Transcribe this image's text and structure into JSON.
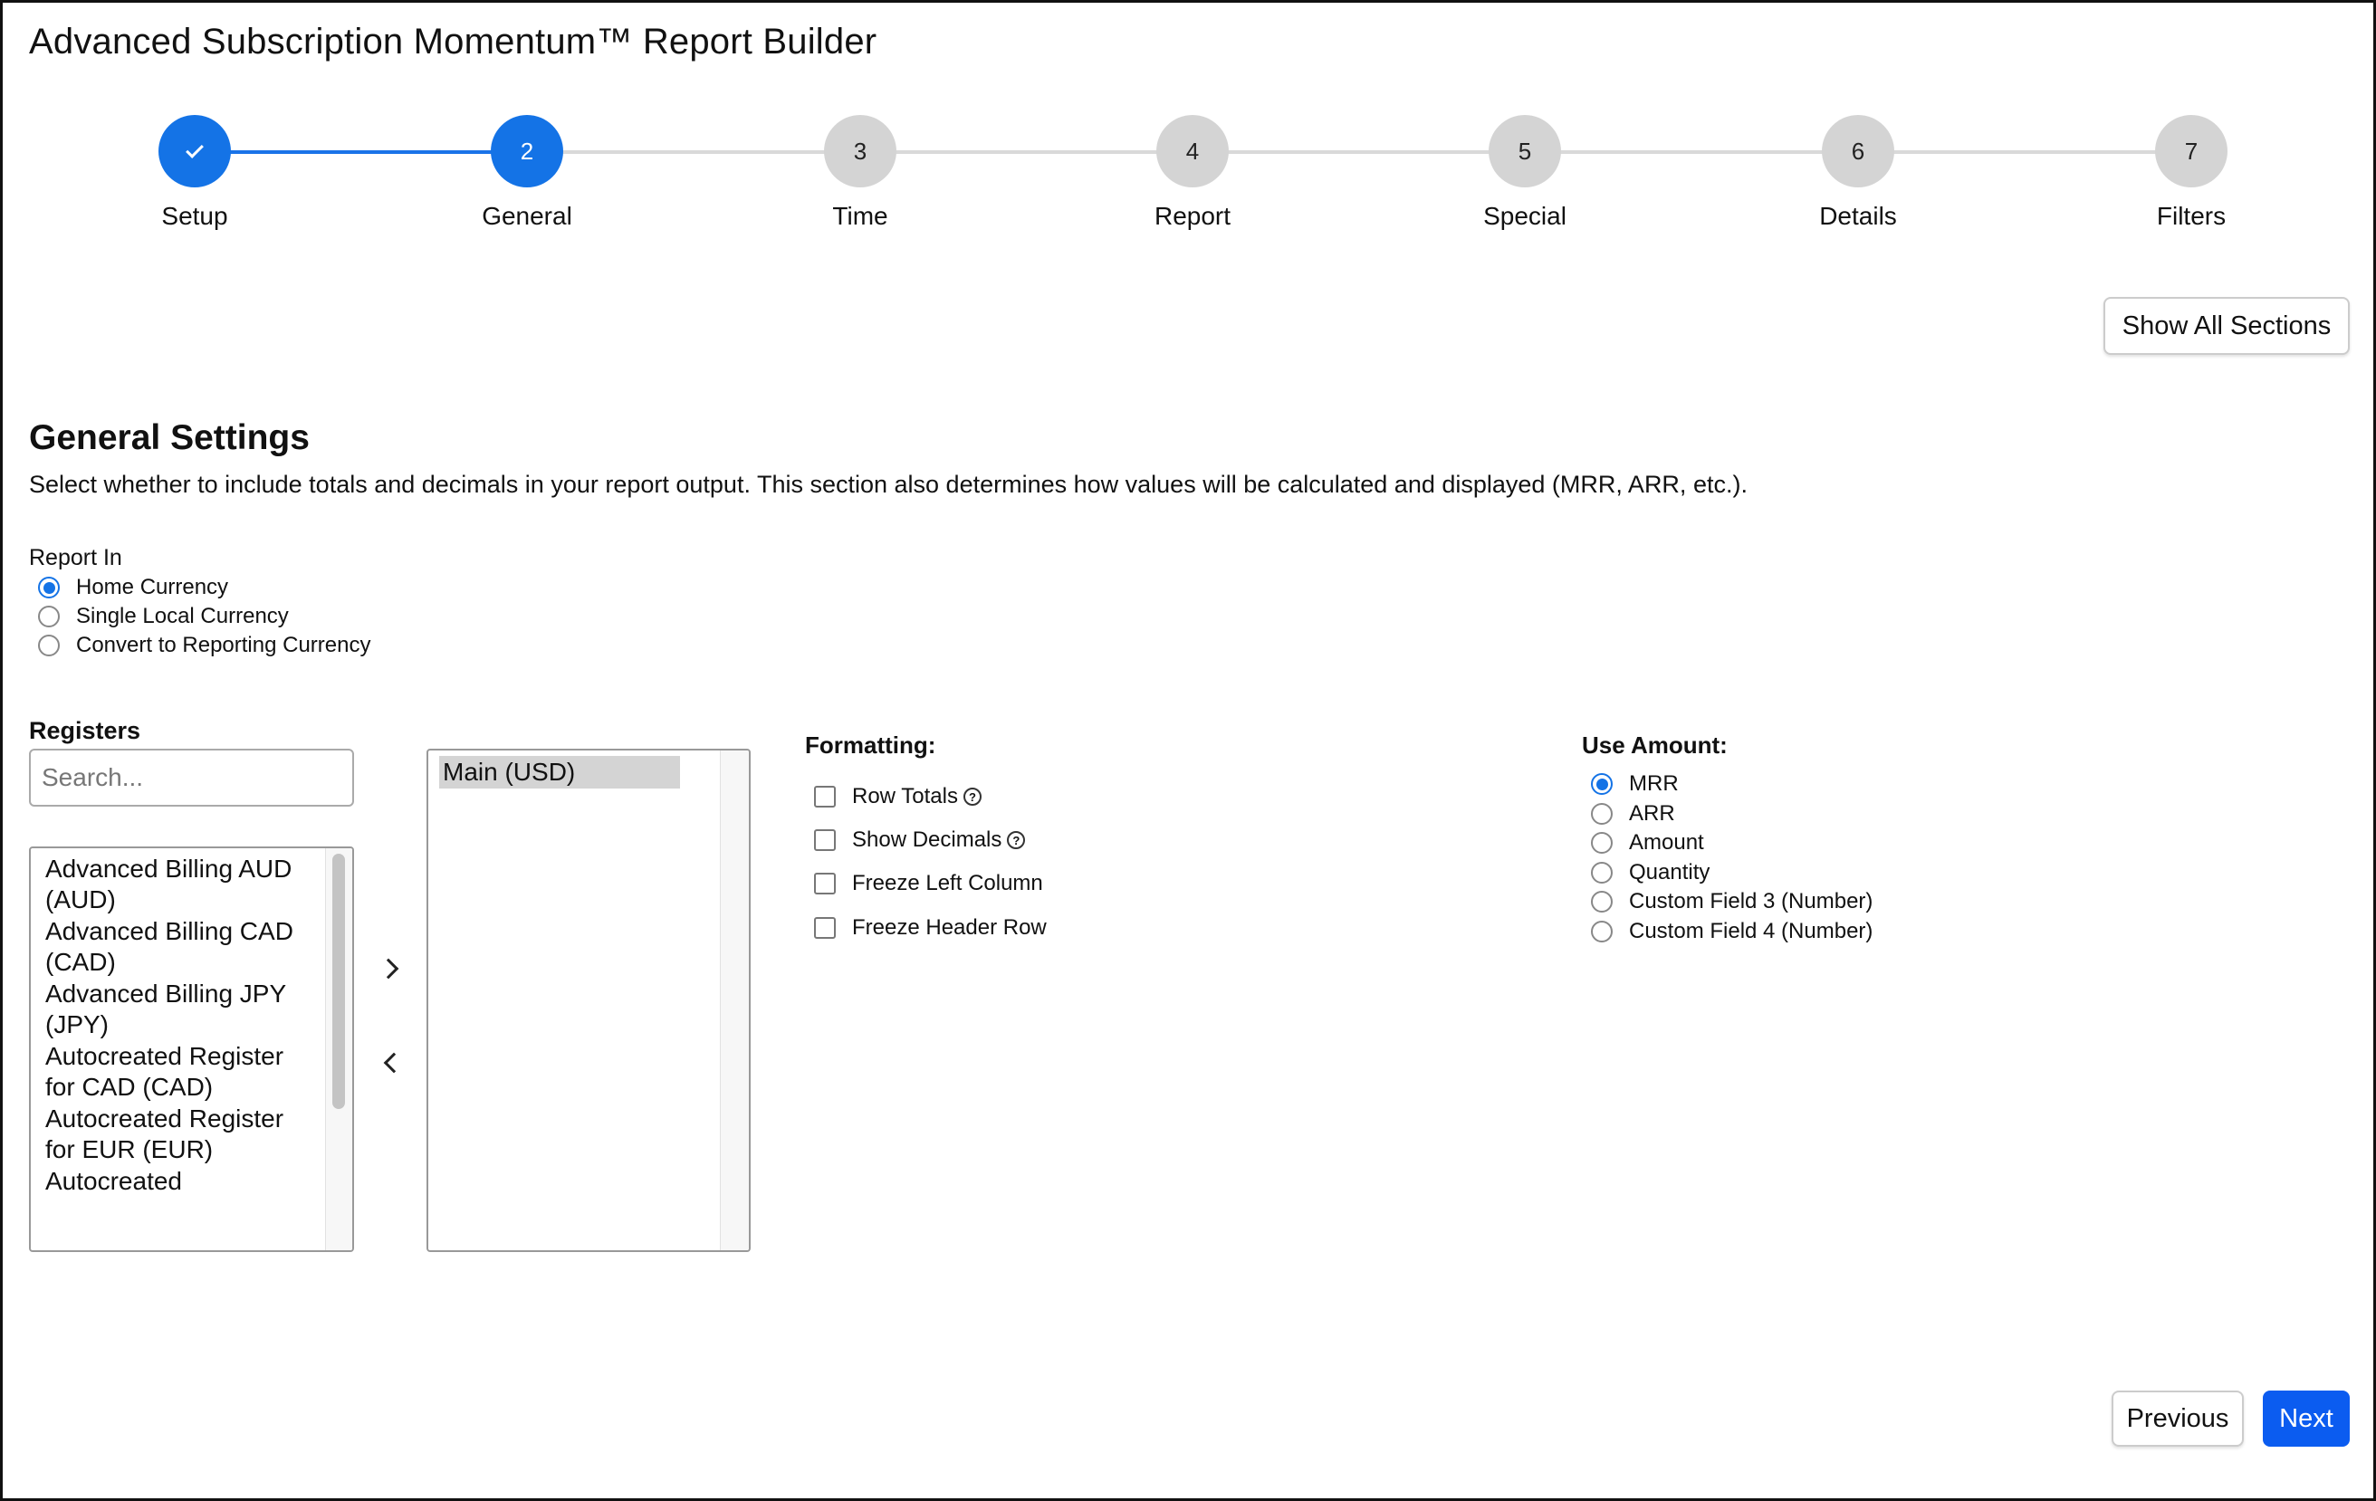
{
  "app": {
    "title": "Advanced Subscription Momentum™ Report Builder"
  },
  "stepper": {
    "steps": [
      {
        "number": "",
        "label": "Setup",
        "state": "completed"
      },
      {
        "number": "2",
        "label": "General",
        "state": "active"
      },
      {
        "number": "3",
        "label": "Time",
        "state": "pending"
      },
      {
        "number": "4",
        "label": "Report",
        "state": "pending"
      },
      {
        "number": "5",
        "label": "Special",
        "state": "pending"
      },
      {
        "number": "6",
        "label": "Details",
        "state": "pending"
      },
      {
        "number": "7",
        "label": "Filters",
        "state": "pending"
      }
    ]
  },
  "toolbar": {
    "show_all_label": "Show All Sections"
  },
  "general": {
    "title": "General Settings",
    "description": "Select whether to include totals and decimals in your report output. This section also determines how values will be calculated and displayed (MRR, ARR, etc.)."
  },
  "report_in": {
    "label": "Report In",
    "options": [
      {
        "label": "Home Currency",
        "checked": true
      },
      {
        "label": "Single Local Currency",
        "checked": false
      },
      {
        "label": "Convert to Reporting Currency",
        "checked": false
      }
    ]
  },
  "registers": {
    "label": "Registers",
    "search_placeholder": "Search...",
    "available": [
      "Advanced Billing AUD (AUD)",
      "Advanced Billing CAD (CAD)",
      "Advanced Billing JPY (JPY)",
      "Autocreated Register for CAD (CAD)",
      "Autocreated Register for EUR (EUR)",
      "Autocreated"
    ],
    "selected": [
      "Main (USD)"
    ]
  },
  "formatting": {
    "label": "Formatting:",
    "options": [
      {
        "label": "Row Totals",
        "help": true,
        "checked": false
      },
      {
        "label": "Show Decimals",
        "help": true,
        "checked": false
      },
      {
        "label": "Freeze Left Column",
        "help": false,
        "checked": false
      },
      {
        "label": "Freeze Header Row",
        "help": false,
        "checked": false
      }
    ]
  },
  "use_amount": {
    "label": "Use Amount:",
    "options": [
      {
        "label": "MRR",
        "checked": true
      },
      {
        "label": "ARR",
        "checked": false
      },
      {
        "label": "Amount",
        "checked": false
      },
      {
        "label": "Quantity",
        "checked": false
      },
      {
        "label": "Custom Field 3 (Number)",
        "checked": false
      },
      {
        "label": "Custom Field 4 (Number)",
        "checked": false
      }
    ]
  },
  "footer": {
    "previous_label": "Previous",
    "next_label": "Next"
  },
  "colors": {
    "accent": "#1473e6",
    "primary_button": "#0b5cf0",
    "pending_step": "#d4d4d4"
  }
}
